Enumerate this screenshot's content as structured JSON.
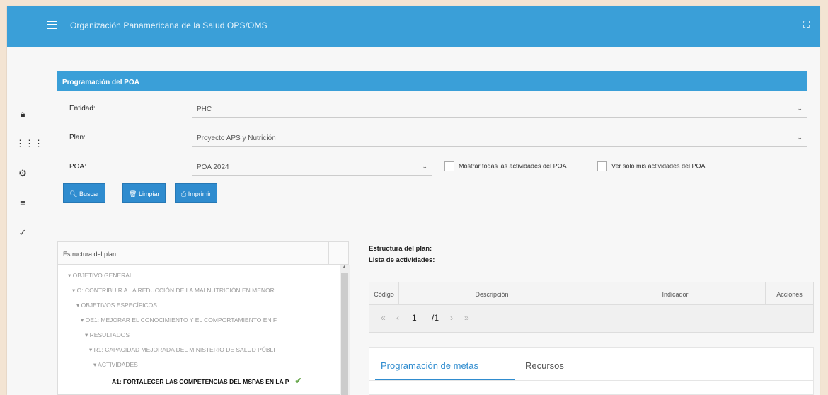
{
  "header": {
    "title": "Organización Panamericana de la Salud OPS/OMS"
  },
  "panel": {
    "title": "Programación del POA"
  },
  "form": {
    "entidad_label": "Entidad:",
    "entidad_value": "PHC",
    "plan_label": "Plan:",
    "plan_value": "Proyecto APS y Nutrición",
    "poa_label": "POA:",
    "poa_value": "POA 2024",
    "show_all_label": "Mostrar todas las actividades del POA",
    "show_mine_label": "Ver solo mis actividades del POA"
  },
  "buttons": {
    "search": "Buscar",
    "clear": "Limpiar",
    "print": "Imprimir"
  },
  "tree": {
    "header": "Estructura del plan",
    "rows": [
      "OBJETIVO GENERAL",
      "O: CONTRIBUIR A LA REDUCCIÓN DE LA MALNUTRICIÓN EN MENOR",
      "OBJETIVOS ESPECÍFICOS",
      "OE1: MEJORAR EL CONOCIMIENTO Y EL COMPORTAMIENTO EN F",
      "RESULTADOS",
      "R1: CAPACIDAD MEJORADA DEL MINISTERIO DE SALUD PÚBLI",
      "ACTIVIDADES",
      "A1: FORTALECER LAS COMPETENCIAS DEL MSPAS EN LA P"
    ]
  },
  "info": {
    "structure_label": "Estructura del plan:",
    "activities_label": "Lista de actividades:"
  },
  "grid": {
    "columns": [
      "Código",
      "Descripción",
      "Indicador",
      "Acciones"
    ],
    "pager": {
      "first": "«",
      "prev": "‹",
      "current": "1",
      "total": "/1",
      "next": "›",
      "last": "»"
    }
  },
  "tabs": {
    "items": [
      "Programación de metas",
      "Recursos"
    ]
  },
  "colors": {
    "primary": "#3a9fd8",
    "button": "#2f8ccf",
    "check": "#6aa84f"
  }
}
